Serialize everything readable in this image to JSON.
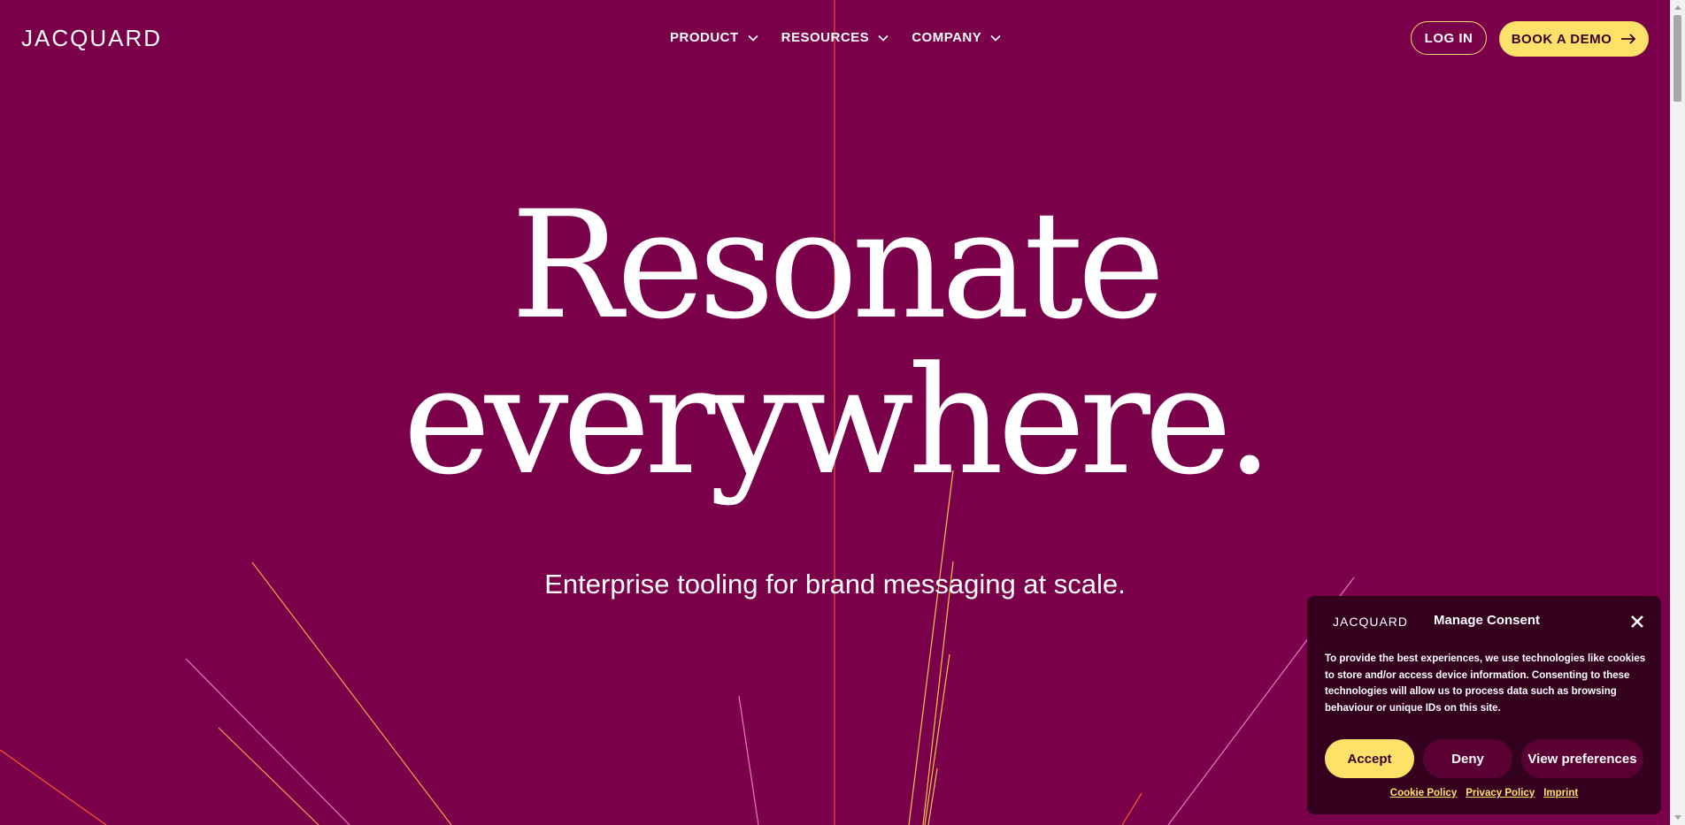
{
  "brand": {
    "logo": "JACQUARD"
  },
  "nav": {
    "items": [
      {
        "label": "PRODUCT"
      },
      {
        "label": "RESOURCES"
      },
      {
        "label": "COMPANY"
      }
    ],
    "login_label": "LOG IN",
    "demo_label": "BOOK A DEMO"
  },
  "hero": {
    "title_line1": "Resonate",
    "title_line2": "everywhere.",
    "subtitle": "Enterprise tooling for brand messaging at scale."
  },
  "consent": {
    "logo": "JACQUARD",
    "title": "Manage Consent",
    "text": "To provide the best experiences, we use technologies like cookies to store and/or access device information. Consenting to these technologies will allow us to process data such as browsing behaviour or unique IDs on this site.",
    "accept_label": "Accept",
    "deny_label": "Deny",
    "prefs_label": "View preferences",
    "links": [
      "Cookie Policy",
      "Privacy Policy",
      "Imprint"
    ]
  },
  "colors": {
    "background": "#7a004a",
    "accent_yellow": "#fde26a",
    "panel": "#33001d",
    "line_orange": "#ff7a3d",
    "line_pink": "#ff6ad5"
  },
  "icons": {
    "chevron": "chevron-down-icon",
    "arrow": "arrow-right-icon",
    "close": "close-icon"
  }
}
